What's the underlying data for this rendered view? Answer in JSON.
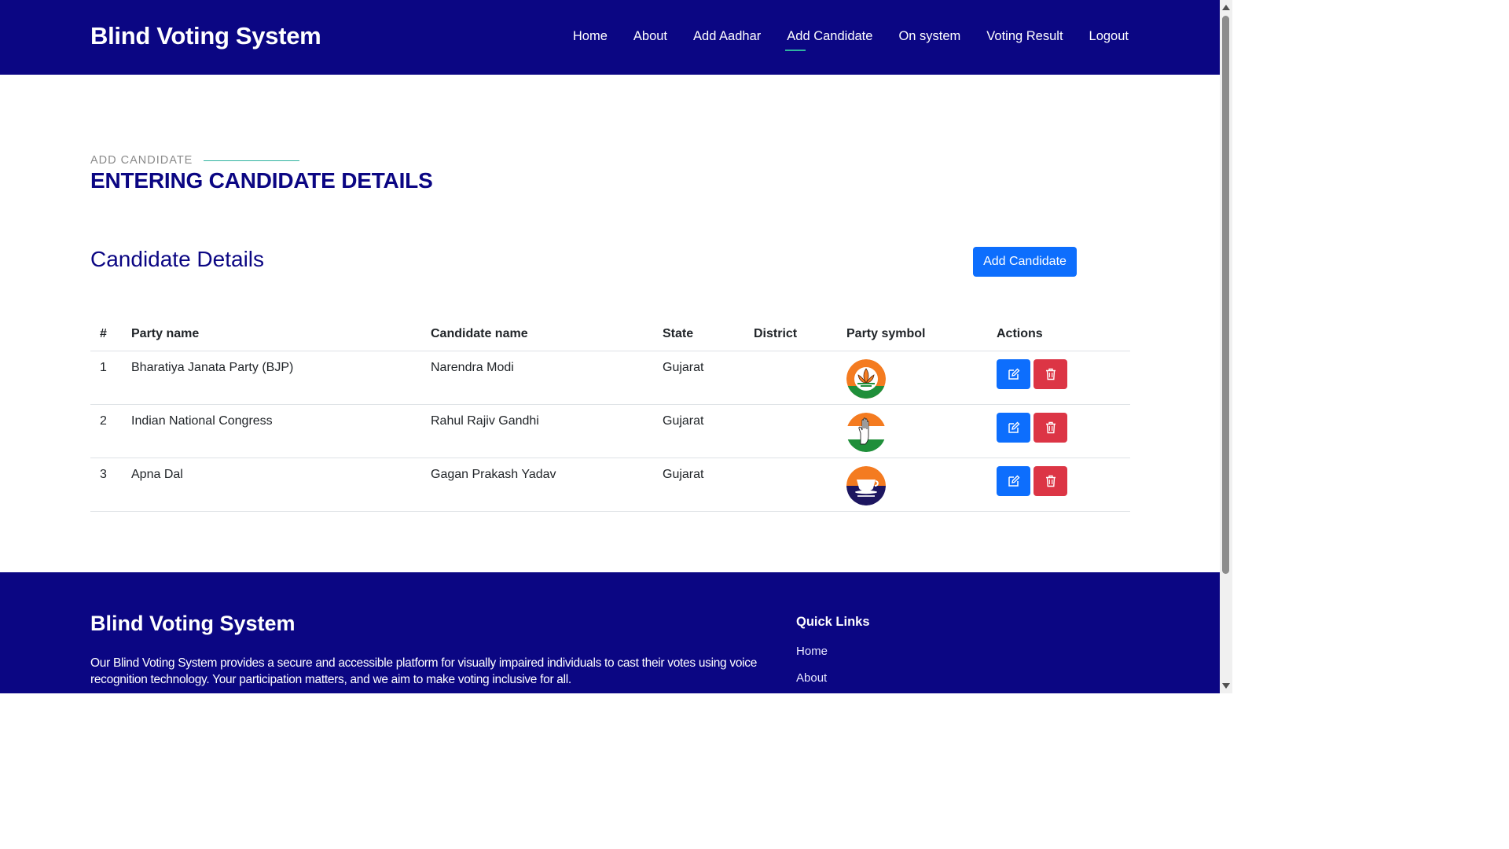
{
  "header": {
    "brand": "Blind Voting System",
    "nav": [
      {
        "label": "Home",
        "active": false
      },
      {
        "label": "About",
        "active": false
      },
      {
        "label": "Add Aadhar",
        "active": false
      },
      {
        "label": "Add Candidate",
        "active": true
      },
      {
        "label": "On system",
        "active": false
      },
      {
        "label": "Voting Result",
        "active": false
      },
      {
        "label": "Logout",
        "active": false
      }
    ]
  },
  "section": {
    "subtitle": "ADD CANDIDATE",
    "title": "ENTERING CANDIDATE DETAILS"
  },
  "card": {
    "title": "Candidate Details",
    "add_button": "Add Candidate"
  },
  "table": {
    "columns": [
      "#",
      "Party name",
      "Candidate name",
      "State",
      "District",
      "Party symbol",
      "Actions"
    ],
    "rows": [
      {
        "num": "1",
        "party": "Bharatiya Janata Party (BJP)",
        "candidate": "Narendra Modi",
        "state": "Gujarat",
        "district": "",
        "symbol": "lotus-icon"
      },
      {
        "num": "2",
        "party": "Indian National Congress",
        "candidate": "Rahul Rajiv Gandhi",
        "state": "Gujarat",
        "district": "",
        "symbol": "hand-icon"
      },
      {
        "num": "3",
        "party": "Apna Dal",
        "candidate": "Gagan Prakash Yadav",
        "state": "Gujarat",
        "district": "",
        "symbol": "cup-saucer-icon"
      }
    ]
  },
  "footer": {
    "brand": "Blind Voting System",
    "description": "Our Blind Voting System provides a secure and accessible platform for visually impaired individuals to cast their votes using voice recognition technology. Your participation matters, and we aim to make voting inclusive for all.",
    "quick_links_title": "Quick Links",
    "links": [
      "Home",
      "About"
    ]
  },
  "colors": {
    "primary_navy": "#0b0683",
    "accent_teal": "#2fb3a0",
    "button_blue": "#0d6efd",
    "button_red": "#dc3545"
  }
}
